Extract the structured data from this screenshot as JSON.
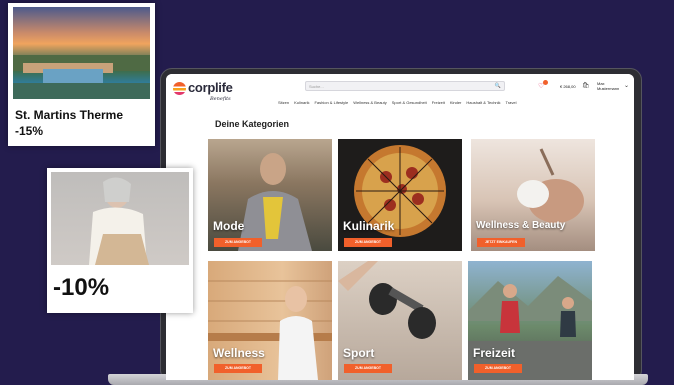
{
  "promo1": {
    "title": "St. Martins Therme",
    "discount": "-15%"
  },
  "promo2": {
    "discount": "-10%"
  },
  "header": {
    "logo": "corplife",
    "logo_sub": "Benefits",
    "search_placeholder": "Suche...",
    "balance": "€ 268,00",
    "user_name": "Max Mustermann",
    "nav": [
      "Sitzen",
      "Kulinarik",
      "Fashion & Lifestyle",
      "Wellness & Beauty",
      "Sport & Gesundheit",
      "Freizeit",
      "Kinder",
      "Haushalt & Technik",
      "Travel"
    ]
  },
  "main": {
    "title": "Deine Kategorien",
    "cards": [
      {
        "label": "Mode",
        "button": "ZUM ANGEBOT"
      },
      {
        "label": "Kulinarik",
        "button": "ZUM ANGEBOT"
      },
      {
        "label": "Wellness & Beauty",
        "button": "JETZT EINKAUFEN"
      },
      {
        "label": "Wellness",
        "button": "ZUM ANGEBOT"
      },
      {
        "label": "Sport",
        "button": "ZUM ANGEBOT"
      },
      {
        "label": "Freizeit",
        "button": "ZUM ANGEBOT"
      }
    ]
  },
  "colors": {
    "background": "#231c4d",
    "accent": "#f1602b",
    "brand_pink": "#e2386a"
  },
  "icons": [
    "search-icon",
    "heart-icon",
    "cart-icon",
    "chevron-down-icon"
  ]
}
